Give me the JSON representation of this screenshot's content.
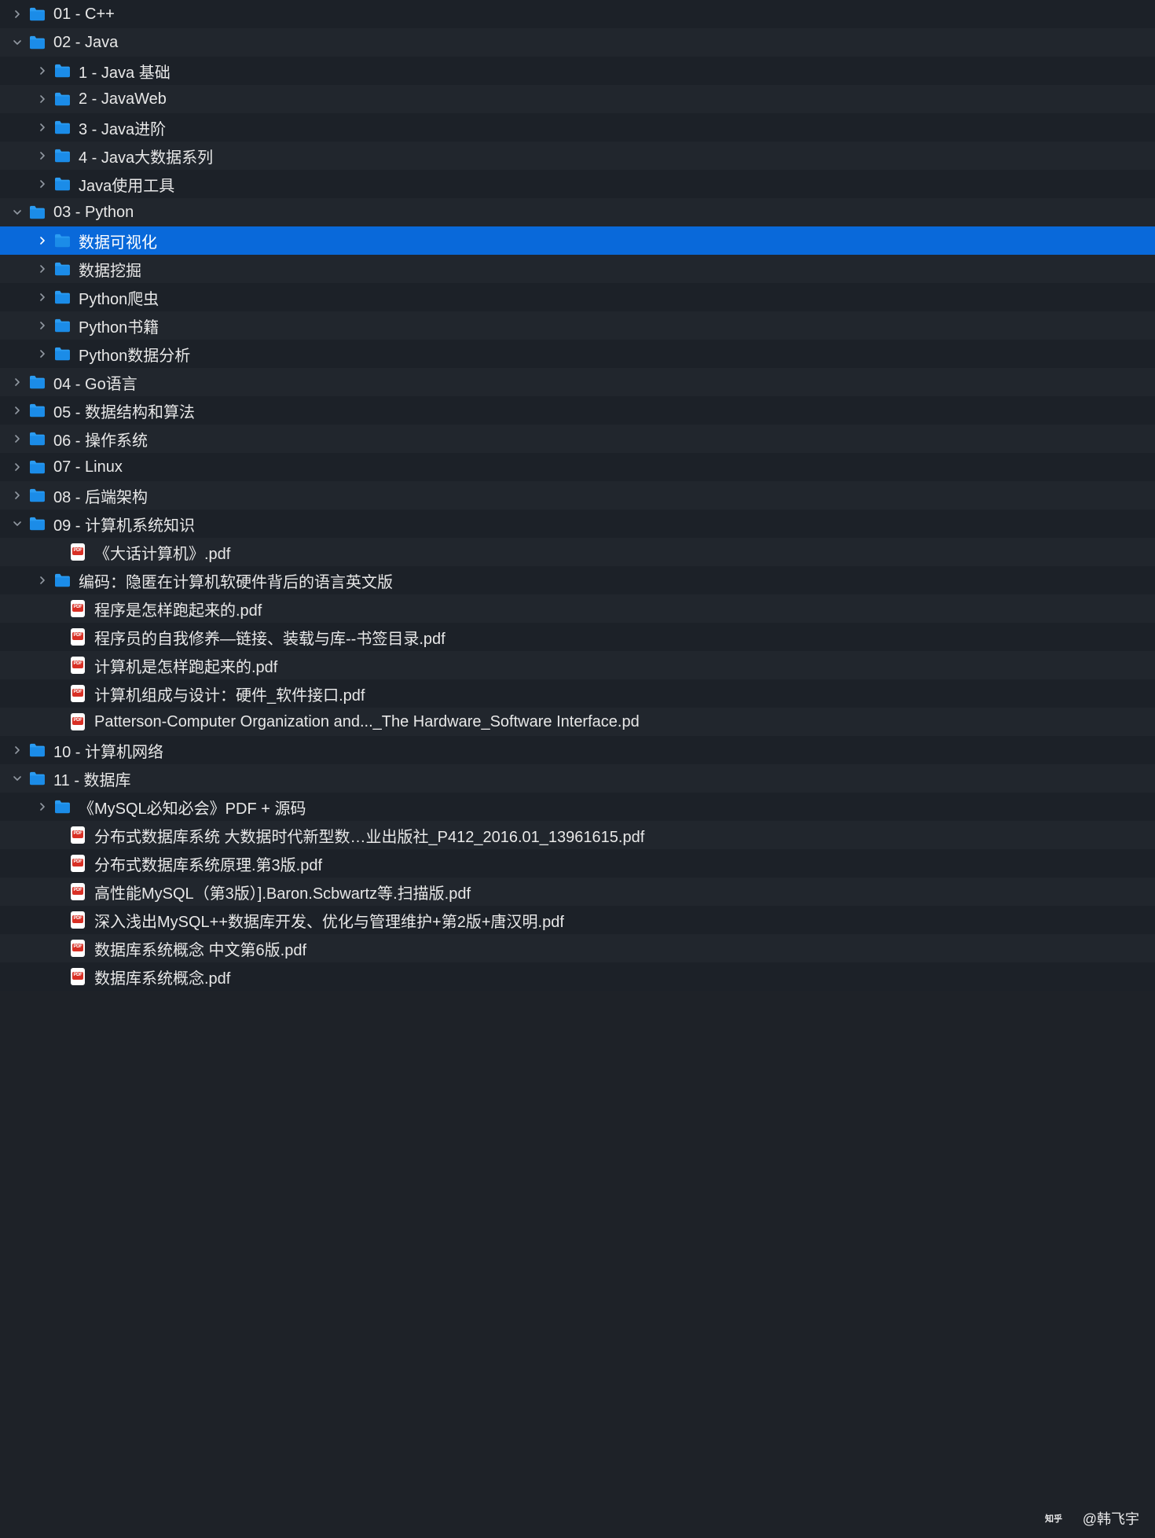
{
  "watermark": {
    "text": "@韩飞宇"
  },
  "tree": [
    {
      "level": 0,
      "type": "folder",
      "expand": "closed",
      "label": "01 - C++",
      "selected": false
    },
    {
      "level": 0,
      "type": "folder",
      "expand": "open",
      "label": "02 - Java",
      "selected": false
    },
    {
      "level": 1,
      "type": "folder",
      "expand": "closed",
      "label": "1 - Java 基础",
      "selected": false
    },
    {
      "level": 1,
      "type": "folder",
      "expand": "closed",
      "label": "2 - JavaWeb",
      "selected": false
    },
    {
      "level": 1,
      "type": "folder",
      "expand": "closed",
      "label": "3 - Java进阶",
      "selected": false
    },
    {
      "level": 1,
      "type": "folder",
      "expand": "closed",
      "label": "4 - Java大数据系列",
      "selected": false
    },
    {
      "level": 1,
      "type": "folder",
      "expand": "closed",
      "label": "Java使用工具",
      "selected": false
    },
    {
      "level": 0,
      "type": "folder",
      "expand": "open",
      "label": "03 - Python",
      "selected": false
    },
    {
      "level": 1,
      "type": "folder",
      "expand": "closed",
      "label": "数据可视化",
      "selected": true
    },
    {
      "level": 1,
      "type": "folder",
      "expand": "closed",
      "label": "数据挖掘",
      "selected": false
    },
    {
      "level": 1,
      "type": "folder",
      "expand": "closed",
      "label": "Python爬虫",
      "selected": false
    },
    {
      "level": 1,
      "type": "folder",
      "expand": "closed",
      "label": "Python书籍",
      "selected": false
    },
    {
      "level": 1,
      "type": "folder",
      "expand": "closed",
      "label": "Python数据分析",
      "selected": false
    },
    {
      "level": 0,
      "type": "folder",
      "expand": "closed",
      "label": "04 - Go语言",
      "selected": false
    },
    {
      "level": 0,
      "type": "folder",
      "expand": "closed",
      "label": "05 - 数据结构和算法",
      "selected": false
    },
    {
      "level": 0,
      "type": "folder",
      "expand": "closed",
      "label": "06 - 操作系统",
      "selected": false
    },
    {
      "level": 0,
      "type": "folder",
      "expand": "closed",
      "label": "07 - Linux",
      "selected": false
    },
    {
      "level": 0,
      "type": "folder",
      "expand": "closed",
      "label": "08 - 后端架构",
      "selected": false
    },
    {
      "level": 0,
      "type": "folder",
      "expand": "open",
      "label": "09 - 计算机系统知识",
      "selected": false
    },
    {
      "level": 2,
      "type": "pdf",
      "expand": "none",
      "label": "《大话计算机》.pdf",
      "selected": false
    },
    {
      "level": 1,
      "type": "folder",
      "expand": "closed",
      "label": "编码：隐匿在计算机软硬件背后的语言英文版",
      "selected": false
    },
    {
      "level": 2,
      "type": "pdf",
      "expand": "none",
      "label": "程序是怎样跑起来的.pdf",
      "selected": false
    },
    {
      "level": 2,
      "type": "pdf",
      "expand": "none",
      "label": "程序员的自我修养—链接、装载与库--书签目录.pdf",
      "selected": false
    },
    {
      "level": 2,
      "type": "pdf",
      "expand": "none",
      "label": "计算机是怎样跑起来的.pdf",
      "selected": false
    },
    {
      "level": 2,
      "type": "pdf",
      "expand": "none",
      "label": "计算机组成与设计：硬件_软件接口.pdf",
      "selected": false
    },
    {
      "level": 2,
      "type": "pdf",
      "expand": "none",
      "label": "Patterson-Computer Organization and..._The Hardware_Software Interface.pd",
      "selected": false
    },
    {
      "level": 0,
      "type": "folder",
      "expand": "closed",
      "label": "10 - 计算机网络",
      "selected": false
    },
    {
      "level": 0,
      "type": "folder",
      "expand": "open",
      "label": "11 - 数据库",
      "selected": false
    },
    {
      "level": 1,
      "type": "folder",
      "expand": "closed",
      "label": "《MySQL必知必会》PDF + 源码",
      "selected": false
    },
    {
      "level": 2,
      "type": "pdf",
      "expand": "none",
      "label": "分布式数据库系统  大数据时代新型数…业出版社_P412_2016.01_13961615.pdf",
      "selected": false
    },
    {
      "level": 2,
      "type": "pdf",
      "expand": "none",
      "label": "分布式数据库系统原理.第3版.pdf",
      "selected": false
    },
    {
      "level": 2,
      "type": "pdf",
      "expand": "none",
      "label": "高性能MySQL（第3版）].Baron.Scbwartz等.扫描版.pdf",
      "selected": false
    },
    {
      "level": 2,
      "type": "pdf",
      "expand": "none",
      "label": "深入浅出MySQL++数据库开发、优化与管理维护+第2版+唐汉明.pdf",
      "selected": false
    },
    {
      "level": 2,
      "type": "pdf",
      "expand": "none",
      "label": "数据库系统概念 中文第6版.pdf",
      "selected": false
    },
    {
      "level": 2,
      "type": "pdf",
      "expand": "none",
      "label": "数据库系统概念.pdf",
      "selected": false
    }
  ]
}
